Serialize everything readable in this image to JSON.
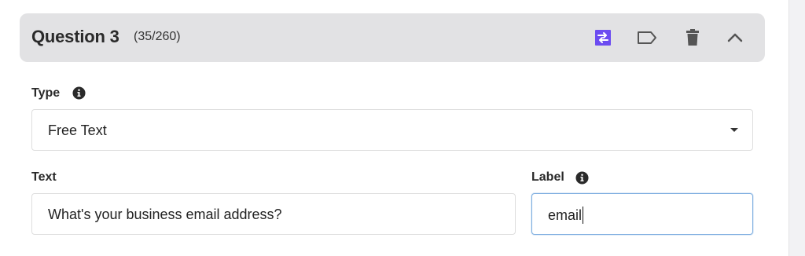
{
  "question": {
    "title": "Question 3",
    "count": "(35/260)"
  },
  "header_actions": [
    {
      "name": "shuffle-icon",
      "color": "#6c4cf1"
    },
    {
      "name": "tag-icon",
      "color": "#555555"
    },
    {
      "name": "trash-icon",
      "color": "#555555"
    },
    {
      "name": "chevron-up-icon",
      "color": "#555555"
    }
  ],
  "type_field": {
    "label": "Type",
    "value": "Free Text"
  },
  "text_field": {
    "label": "Text",
    "value": "What's your business email address?"
  },
  "label_field": {
    "label": "Label",
    "value": "email"
  },
  "colors": {
    "accent": "#6c4cf1",
    "header_bg": "#e2e2e4",
    "focus_border": "#7eaee0"
  }
}
